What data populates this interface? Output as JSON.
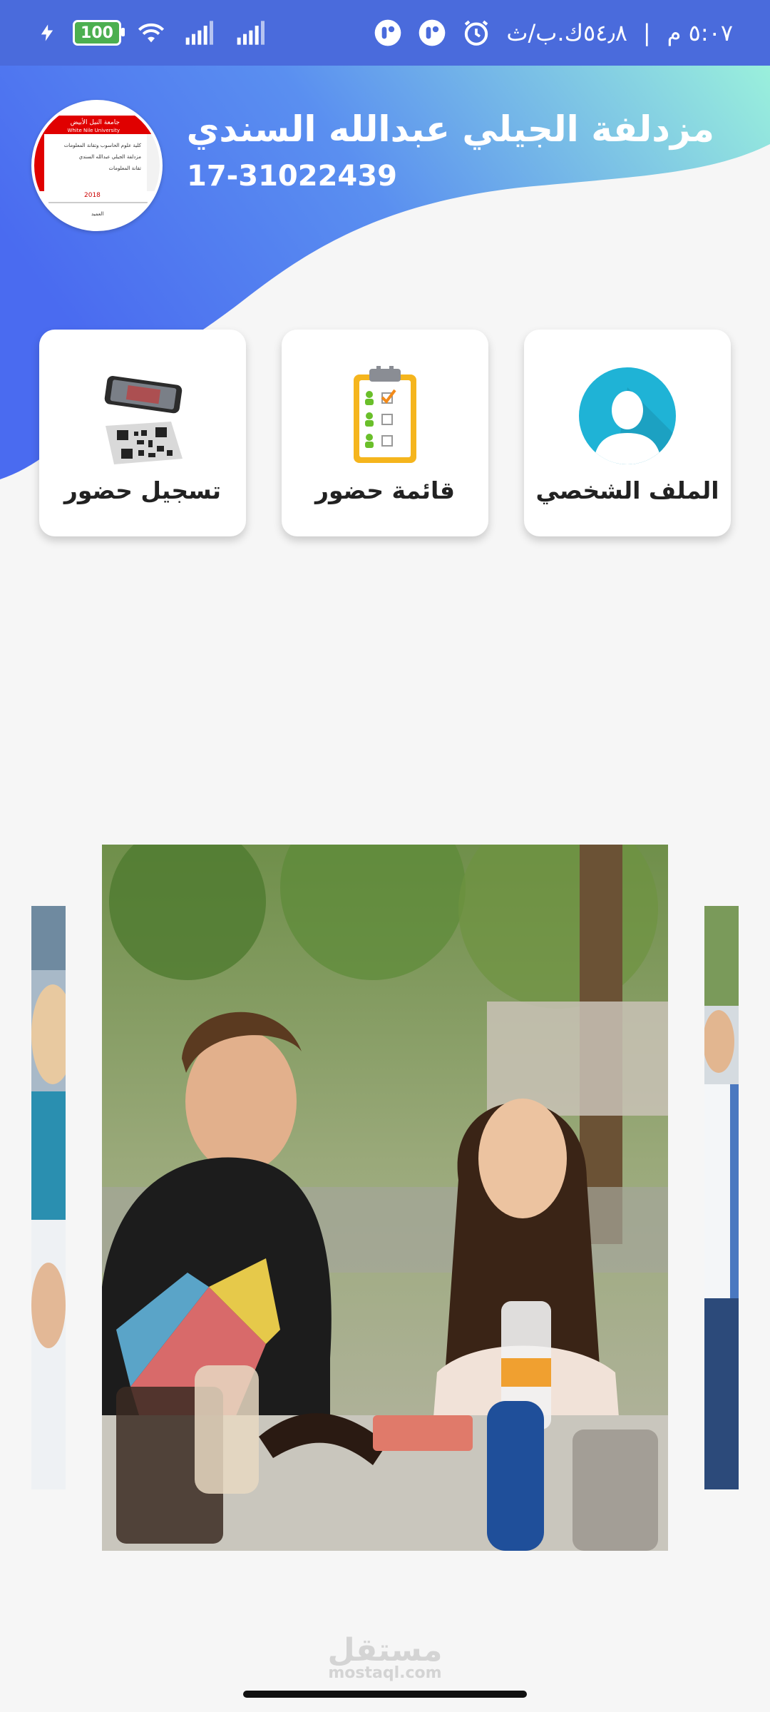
{
  "status_bar": {
    "time": "٥:٠٧ م",
    "network_speed": "٥٤٫٨ك.ب/ث",
    "battery": "100",
    "icons": [
      "charging-icon",
      "battery-icon",
      "wifi-icon",
      "signal-icon",
      "signal-icon",
      "app-notification-icon",
      "app-notification-icon",
      "alarm-icon"
    ]
  },
  "header": {
    "user_name": "مزدلفة الجيلي عبدالله السندي",
    "user_id": "17-31022439",
    "avatar_texts": {
      "university_ar": "جامعة النيل الأبيض",
      "university_en": "White Nile University",
      "faculty": "كلية علوم الحاسوب وتقانة المعلومات",
      "name_line": "مزدلفة الجيلي عبدالله السندي",
      "dept": "تقانة المعلومات",
      "year": "2018",
      "dean": "العميد"
    },
    "colors": {
      "gradient_start": "#4a6bf0",
      "gradient_end": "#9af0dc"
    }
  },
  "cards": [
    {
      "label": "الملف الشخصي",
      "icon": "profile-icon"
    },
    {
      "label": "قائمة حضور",
      "icon": "checklist-icon"
    },
    {
      "label": "تسجيل حضور",
      "icon": "qr-scan-icon"
    }
  ],
  "carousel": {
    "slides": [
      "students-photo-left",
      "students-photo-main",
      "students-photo-right"
    ]
  },
  "watermark": {
    "ar": "مستقل",
    "en": "mostaql.com"
  }
}
